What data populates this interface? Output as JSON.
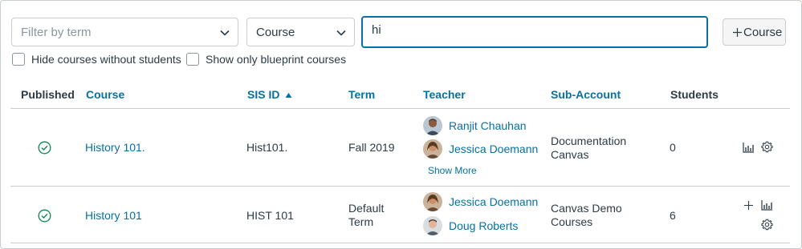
{
  "filters": {
    "term_placeholder": "Filter by term",
    "search_by": "Course",
    "search_value": "hi",
    "add_course_label": "Course",
    "hide_without_students_label": "Hide courses without students",
    "blueprint_only_label": "Show only blueprint courses"
  },
  "table": {
    "headers": {
      "published": "Published",
      "course": "Course",
      "sis_id": "SIS ID",
      "term": "Term",
      "teacher": "Teacher",
      "sub_account": "Sub-Account",
      "students": "Students"
    },
    "rows": [
      {
        "course": "History 101.",
        "sis_id": "Hist101.",
        "term": "Fall 2019",
        "teachers": [
          "Ranjit Chauhan",
          "Jessica Doemann"
        ],
        "show_more": "Show More",
        "sub_account_line1": "Documentation",
        "sub_account_line2": "Canvas",
        "students": "0"
      },
      {
        "course": "History 101",
        "sis_id": "HIST 101",
        "term_line1": "Default",
        "term_line2": "Term",
        "teachers": [
          "Jessica Doemann",
          "Doug Roberts"
        ],
        "sub_account_line1": "Canvas Demo",
        "sub_account_line2": "Courses",
        "students": "6"
      }
    ]
  },
  "colors": {
    "link": "#0770a3",
    "text": "#2d3b45",
    "published_check": "#0b874b",
    "border": "#c7cdd1"
  },
  "icons": {
    "published": "check-circle-icon",
    "statistics": "bar-chart-icon",
    "settings": "gear-icon",
    "add_user": "plus-icon",
    "sort": "triangle-up-icon",
    "dropdown": "chevron-down-icon"
  }
}
